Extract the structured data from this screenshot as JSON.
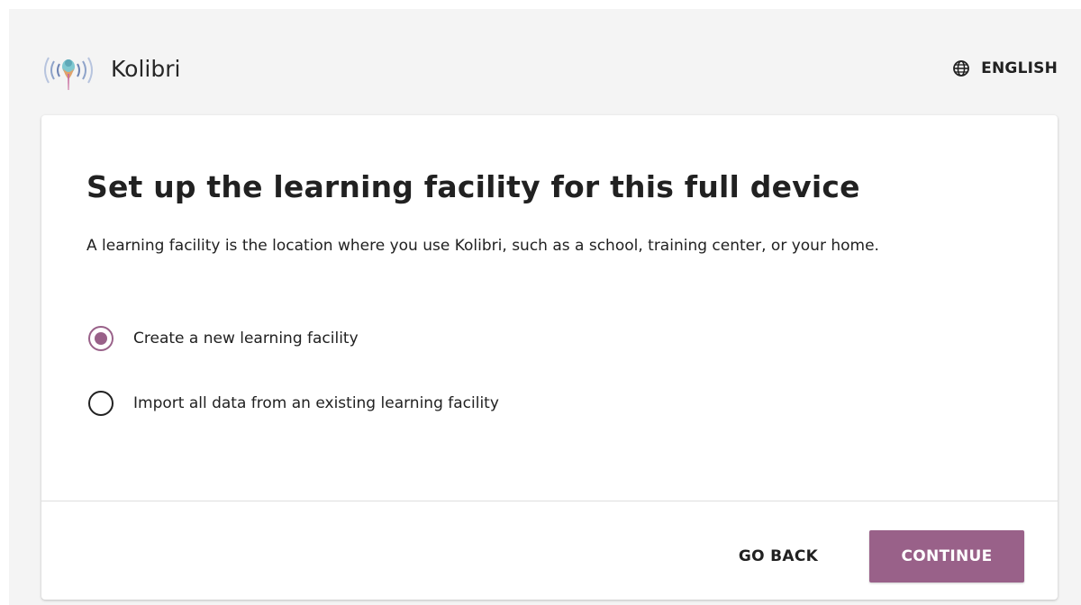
{
  "header": {
    "app_title": "Kolibri",
    "logo_icon": "kolibri-hummingbird-logo",
    "language_icon": "globe-icon",
    "language_label": "ENGLISH"
  },
  "card": {
    "title": "Set up the learning facility for this full device",
    "description": "A learning facility is the location where you use Kolibri, such as a school, training center, or your home.",
    "options": [
      {
        "label": "Create a new learning facility",
        "selected": true
      },
      {
        "label": "Import all data from an existing learning facility",
        "selected": false
      }
    ]
  },
  "footer": {
    "go_back_label": "GO BACK",
    "continue_label": "CONTINUE"
  },
  "colors": {
    "accent": "#996189",
    "page_background": "#f4f4f4",
    "card_background": "#ffffff",
    "text": "#212121"
  }
}
